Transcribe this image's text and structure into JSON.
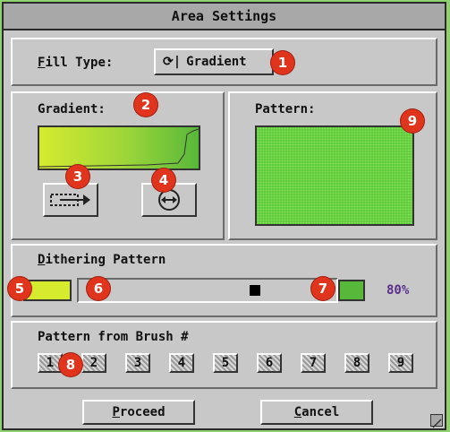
{
  "window": {
    "title": "Area Settings"
  },
  "fill": {
    "label_first": "F",
    "label_rest": "ill Type:",
    "cycle_glyph": "⟳|",
    "value": "Gradient"
  },
  "gradient": {
    "label": "Gradient:"
  },
  "pattern": {
    "label": "Pattern:"
  },
  "dithering": {
    "label_first": "D",
    "label_rest": "ithering Pattern",
    "percent_text": "80%",
    "slider_level": 0.8
  },
  "brush": {
    "label": "Pattern from Brush #",
    "numbers": [
      "1",
      "2",
      "3",
      "4",
      "5",
      "6",
      "7",
      "8",
      "9"
    ]
  },
  "actions": {
    "proceed_first": "P",
    "proceed_rest": "roceed",
    "cancel_first": "C",
    "cancel_rest": "ancel"
  },
  "badges": [
    "1",
    "2",
    "3",
    "4",
    "5",
    "6",
    "7",
    "8",
    "9"
  ],
  "colors": {
    "gradient_start": "#d6ea2e",
    "gradient_end": "#58b83a",
    "pattern_fill": "#5fcc3c",
    "percent_text": "#5a2e8a",
    "badge": "#e0341c"
  }
}
